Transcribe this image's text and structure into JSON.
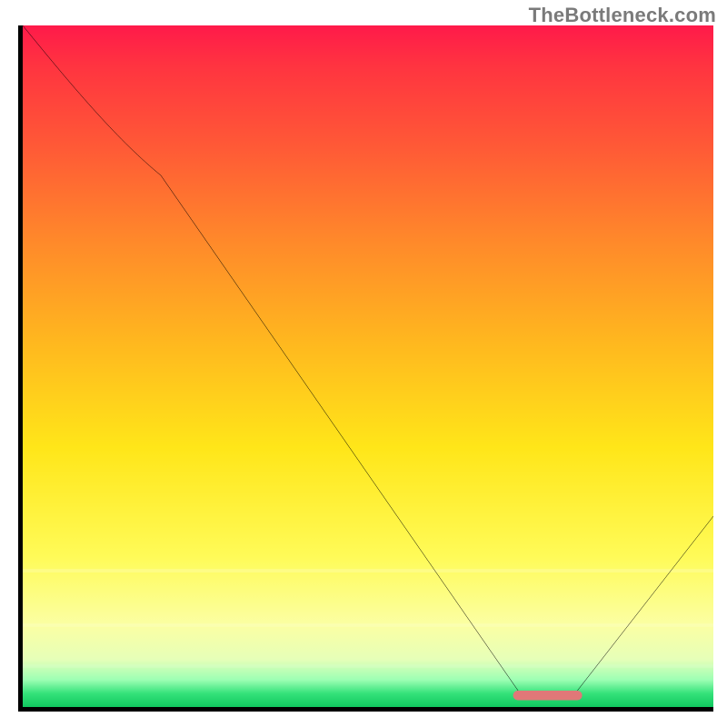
{
  "watermark": {
    "text": "TheBottleneck.com"
  },
  "chart_data": {
    "type": "line",
    "title": "",
    "xlabel": "",
    "ylabel": "",
    "xlim": [
      0,
      100
    ],
    "ylim": [
      0,
      100
    ],
    "grid": false,
    "series": [
      {
        "name": "bottleneck-curve",
        "color": "#000000",
        "x": [
          0,
          20,
          72,
          80,
          100
        ],
        "values": [
          100,
          78,
          2,
          2,
          28
        ]
      }
    ],
    "marker": {
      "name": "sweet-spot-bar",
      "x_start": 71,
      "x_end": 81,
      "y": 1.5,
      "color": "#e07878"
    },
    "bands": [
      {
        "y": 80,
        "label": "yellow-band-top",
        "color": "rgba(255,255,255,0.18)"
      },
      {
        "y": 88,
        "label": "yellow-band-mid",
        "color": "rgba(255,255,255,0.12)"
      },
      {
        "y": 94,
        "label": "green-band",
        "color": "rgba(255,255,255,0.10)"
      }
    ],
    "background": {
      "type": "vertical-gradient",
      "stops": [
        {
          "pct": 0,
          "color": "#ff1a4a"
        },
        {
          "pct": 18,
          "color": "#ff5a36"
        },
        {
          "pct": 46,
          "color": "#ffb61f"
        },
        {
          "pct": 78,
          "color": "#fffb58"
        },
        {
          "pct": 96,
          "color": "#9dffb4"
        },
        {
          "pct": 100,
          "color": "#10c85f"
        }
      ]
    }
  }
}
